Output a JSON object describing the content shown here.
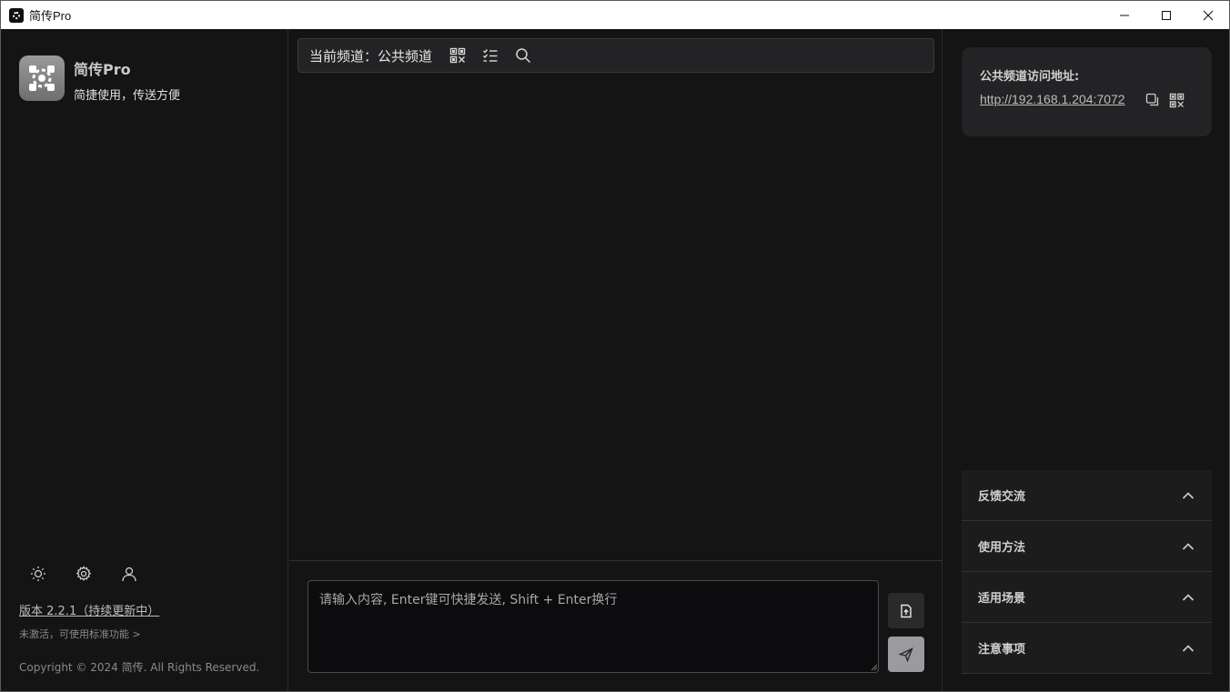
{
  "window": {
    "title": "简传Pro",
    "controls": [
      "minimize",
      "maximize",
      "close"
    ]
  },
  "sidebar": {
    "brand_name": "简传Pro",
    "brand_tagline": "简捷使用，传送方便",
    "icons": [
      "sun-icon",
      "gear-icon",
      "user-icon"
    ],
    "version": "版本 2.2.1（持续更新中）",
    "activation": "未激活，可使用标准功能 >",
    "copyright": "Copyright © 2024 简传. All Rights Reserved."
  },
  "main": {
    "channel_label": "当前频道：公共频道",
    "channel_icons": [
      "qrcode-icon",
      "list-check-icon",
      "search-icon"
    ],
    "input_placeholder": "请输入内容, Enter键可快捷发送, Shift + Enter换行",
    "input_value": ""
  },
  "right": {
    "address_title": "公共频道访问地址:",
    "address_url": "http://192.168.1.204:7072",
    "accordion": [
      {
        "label": "反馈交流"
      },
      {
        "label": "使用方法"
      },
      {
        "label": "适用场景"
      },
      {
        "label": "注意事项"
      }
    ]
  },
  "colors": {
    "background": "#141414",
    "panel": "#232325",
    "send_button": "#9b9b9f"
  }
}
